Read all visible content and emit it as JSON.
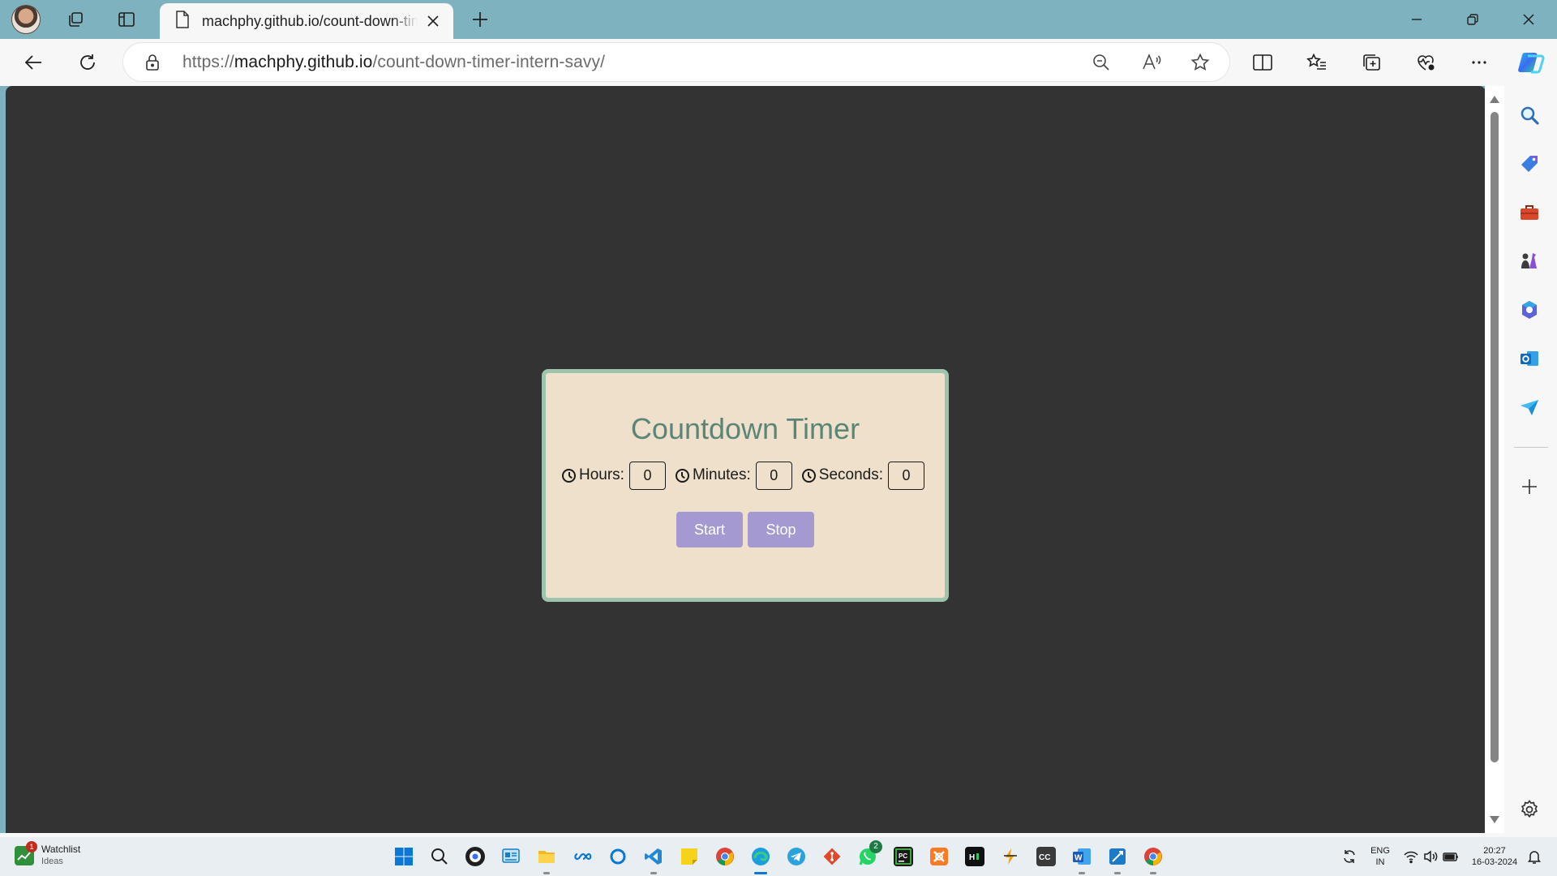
{
  "browser": {
    "tab": {
      "title": "machphy.github.io/count-down-timer-intern-savy/"
    },
    "address_bar": {
      "scheme": "https://",
      "host": "machphy.github.io",
      "path": "/count-down-timer-intern-savy/"
    }
  },
  "page": {
    "title": "Countdown Timer",
    "fields": [
      {
        "label": "Hours:",
        "value": "0"
      },
      {
        "label": "Minutes:",
        "value": "0"
      },
      {
        "label": "Seconds:",
        "value": "0"
      }
    ],
    "buttons": {
      "start": "Start",
      "stop": "Stop"
    },
    "colors": {
      "page_bg": "#333333",
      "card_bg": "#eee0ca",
      "card_border": "#9ec4ad",
      "title": "#5b8577",
      "button": "#a49ad1"
    }
  },
  "taskbar": {
    "widget": {
      "title": "Watchlist",
      "subtitle": "Ideas",
      "badge": "1"
    },
    "whatsapp_badge": "2",
    "language": {
      "line1": "ENG",
      "line2": "IN"
    },
    "clock": {
      "time": "20:27",
      "date": "16-03-2024"
    }
  }
}
